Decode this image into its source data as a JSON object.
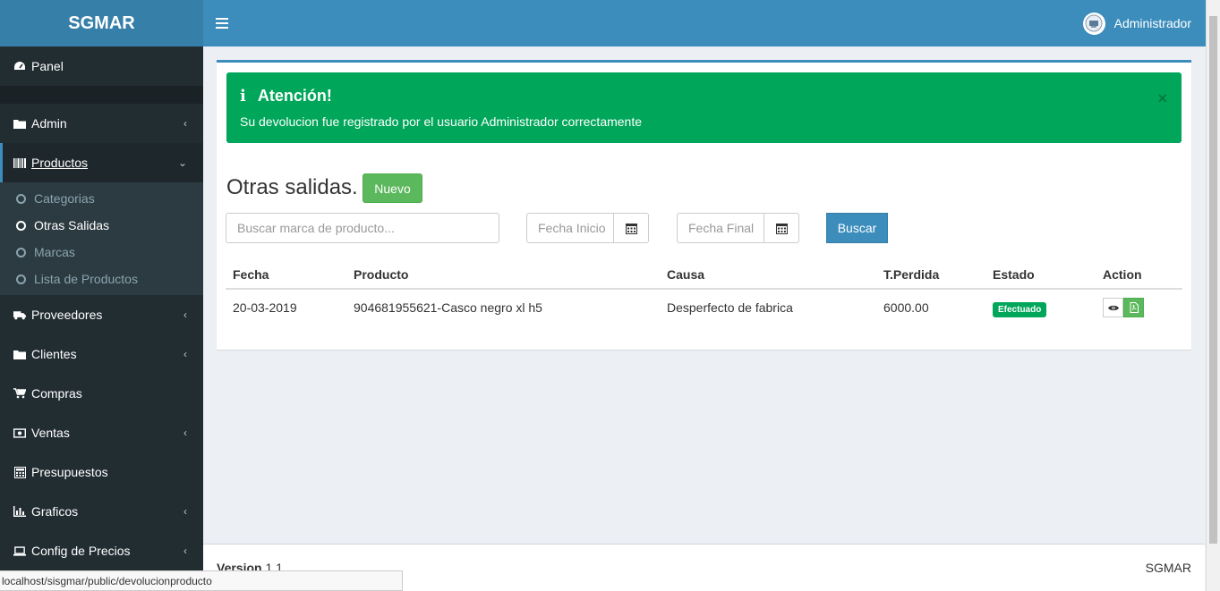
{
  "app": {
    "brand": "SGMAR"
  },
  "sidebar": {
    "panel": {
      "label": "Panel",
      "icon": "dashboard-icon"
    },
    "items": [
      {
        "label": "Admin",
        "icon": "folder-icon"
      },
      {
        "label": "Productos",
        "icon": "barcode-icon"
      },
      {
        "label": "Proveedores",
        "icon": "truck-icon"
      },
      {
        "label": "Clientes",
        "icon": "folder-icon"
      },
      {
        "label": "Compras",
        "icon": "cart-icon"
      },
      {
        "label": "Ventas",
        "icon": "money-icon"
      },
      {
        "label": "Presupuestos",
        "icon": "calculator-icon"
      },
      {
        "label": "Graficos",
        "icon": "bar-chart-icon"
      },
      {
        "label": "Config de Precios",
        "icon": "laptop-icon"
      }
    ],
    "submenu": [
      "Categorias",
      "Otras Salidas",
      "Marcas",
      "Lista de Productos"
    ]
  },
  "header": {
    "user": "Administrador"
  },
  "alert": {
    "title": "Atención!",
    "message": "Su devolucion fue registrado por el usuario Administrador correctamente",
    "close": "×"
  },
  "page": {
    "title": "Otras salidas.",
    "new_button": "Nuevo",
    "search_placeholder": "Buscar marca de producto...",
    "date_start_placeholder": "Fecha Inicio",
    "date_end_placeholder": "Fecha Final",
    "search_button": "Buscar"
  },
  "table": {
    "headers": [
      "Fecha",
      "Producto",
      "Causa",
      "T.Perdida",
      "Estado",
      "Action"
    ],
    "rows": [
      {
        "fecha": "20-03-2019",
        "producto": "904681955621-Casco negro xl h5",
        "causa": "Desperfecto de fabrica",
        "perdida": "6000.00",
        "estado": "Efectuado"
      }
    ]
  },
  "footer": {
    "version_label": "Version",
    "version": "1.1",
    "brand": "SGMAR"
  },
  "statusbar": {
    "url": "localhost/sisgmar/public/devolucionproducto"
  },
  "colors": {
    "header": "#3c8dbc",
    "sidebar": "#222d32",
    "success": "#00a65a",
    "button_green": "#5cb85c"
  }
}
